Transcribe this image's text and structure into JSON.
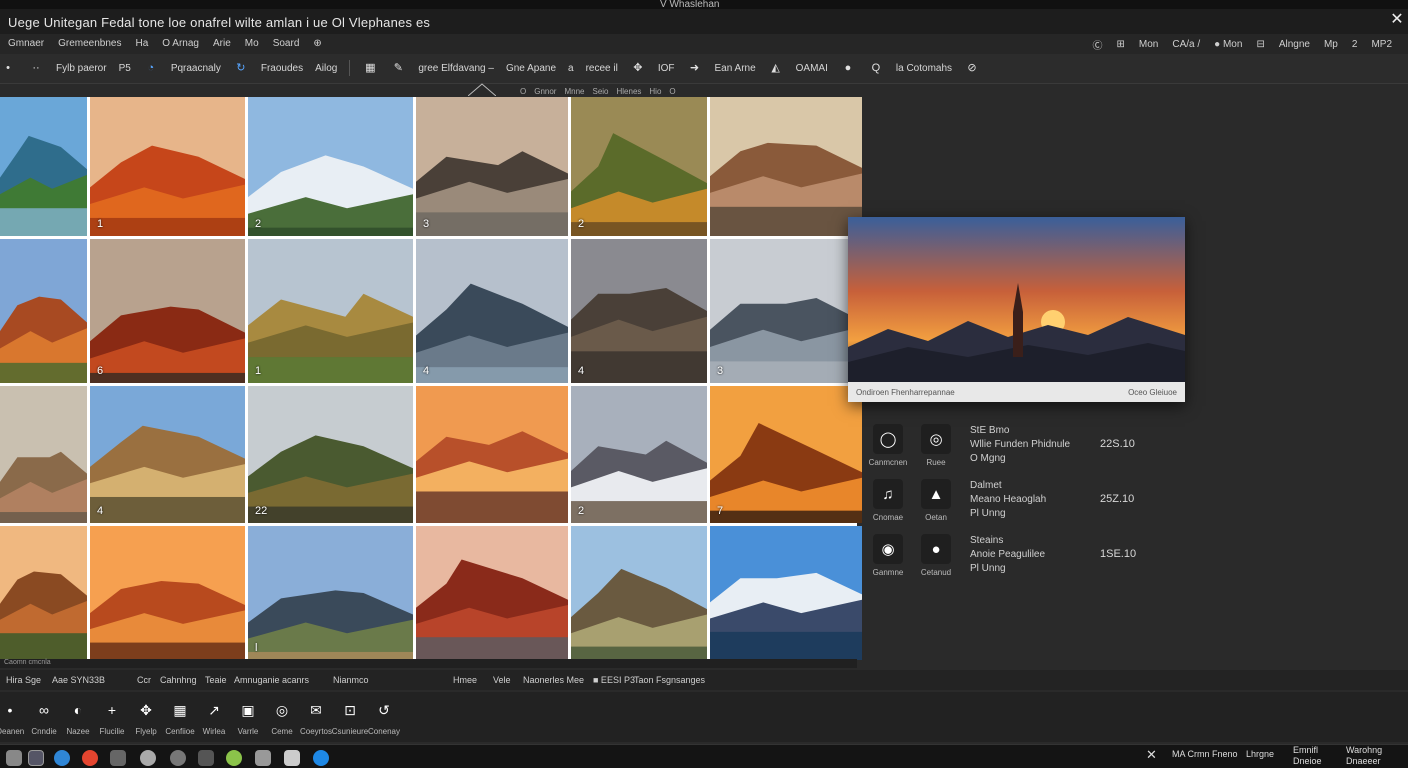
{
  "window": {
    "title": "Uege Unitegan  Fedal tone loe  onafrel wilte  amlan  i  ue  Ol Vlephanes  es",
    "top_center": "V Whaslehan",
    "close_glyph": "✕"
  },
  "menu": {
    "left": [
      "Gmnaer",
      "Gremeenbnes",
      "Ha",
      "O  Arnag",
      "Arie",
      "Mo",
      "Soard",
      "⊕"
    ],
    "right": [
      "Ⓒ",
      "⊞",
      "Mon",
      "CA/a /",
      "● Mon",
      "⊟",
      "Alngne",
      "Mp",
      "2",
      "MP2"
    ]
  },
  "toolbar": {
    "items": [
      "Fylb paeror",
      "P5",
      "Pqraacnaly",
      "Fraoudes",
      "Ailog",
      "gree Elfdavang –",
      "Gne Apane",
      "a",
      "recee  il",
      "IOF",
      "Ean Arne",
      "OAMAI",
      "la Cotomahs"
    ],
    "search_glyph": "Q"
  },
  "subbar": [
    "O",
    "Gnnor",
    "Mnne",
    "Seio",
    "Hlenes",
    "Hio",
    "O"
  ],
  "tiles": [
    {
      "num": ""
    },
    {
      "num": "1"
    },
    {
      "num": "2"
    },
    {
      "num": "3"
    },
    {
      "num": "2"
    },
    {
      "num": ""
    },
    {
      "num": ""
    },
    {
      "num": "6"
    },
    {
      "num": "1"
    },
    {
      "num": "4"
    },
    {
      "num": "4"
    },
    {
      "num": "3"
    },
    {
      "num": ""
    },
    {
      "num": "4"
    },
    {
      "num": "22"
    },
    {
      "num": ""
    },
    {
      "num": "2"
    },
    {
      "num": "7"
    },
    {
      "num": ""
    },
    {
      "num": ""
    },
    {
      "num": "l"
    },
    {
      "num": ""
    },
    {
      "num": ""
    },
    {
      "num": ""
    }
  ],
  "grid_status": "Caomn cmcnla",
  "preview": {
    "caption": "Ondiroen Fhenharrepannae",
    "caption_right": "Oceo Gleiuoe"
  },
  "share_rows": [
    {
      "apps": [
        {
          "label": "Canmcnen",
          "glyph": "◯"
        },
        {
          "label": "Ruee",
          "glyph": "◎"
        }
      ],
      "lines": [
        "StE Bmo",
        "Wllie Funden Phidnule",
        "O Mgng"
      ],
      "size": "22S.10"
    },
    {
      "apps": [
        {
          "label": "Cnomae",
          "glyph": "♫"
        },
        {
          "label": "Oetan",
          "glyph": "▲"
        }
      ],
      "lines": [
        "Dalmet",
        "Meano Heaoglah",
        "Pl Unng"
      ],
      "size": "25Z.10"
    },
    {
      "apps": [
        {
          "label": "Ganmne",
          "glyph": "◉"
        },
        {
          "label": "Cetanud",
          "glyph": "●"
        }
      ],
      "lines": [
        "Steains",
        "Anoie Peagulilee",
        "Pl Unng"
      ],
      "size": "1SE.10"
    }
  ],
  "statusbar": {
    "items": [
      "Hira Sge",
      "Aae  SYN33B",
      "Ccr",
      "Cahnhng",
      "Teaie",
      "Amnuganie acanrs",
      "Nianmco",
      "Hmee",
      "Vele",
      "Naonerles Mee",
      "■ EESI P3",
      "Taon Fsgnsanges"
    ]
  },
  "quickbar": {
    "items": [
      {
        "label": "Oeanen",
        "glyph": "•"
      },
      {
        "label": "Cnndie",
        "glyph": "∞"
      },
      {
        "label": "Nazee",
        "glyph": "◐"
      },
      {
        "label": "Flucilie",
        "glyph": "+"
      },
      {
        "label": "Flyelp",
        "glyph": "✥"
      },
      {
        "label": "Cenfiioe",
        "glyph": "▦"
      },
      {
        "label": "Wirlea",
        "glyph": "↗"
      },
      {
        "label": "Varrle",
        "glyph": "▣"
      },
      {
        "label": "Ceme",
        "glyph": "◎"
      },
      {
        "label": "Coeyrtos",
        "glyph": "✉"
      },
      {
        "label": "Csunieure",
        "glyph": "⊡"
      },
      {
        "label": "Conenay",
        "glyph": "↺"
      }
    ]
  },
  "tray": {
    "items": [
      "✕",
      "MA Crmn Fneno",
      "Lhrgne",
      "Emnifl",
      "Dneioe",
      "Warohng",
      "Dnaeeer"
    ]
  },
  "colors": {
    "accent": "#58a6ff",
    "background": "#2a2a2a",
    "titlebar": "#1d1d1d"
  }
}
